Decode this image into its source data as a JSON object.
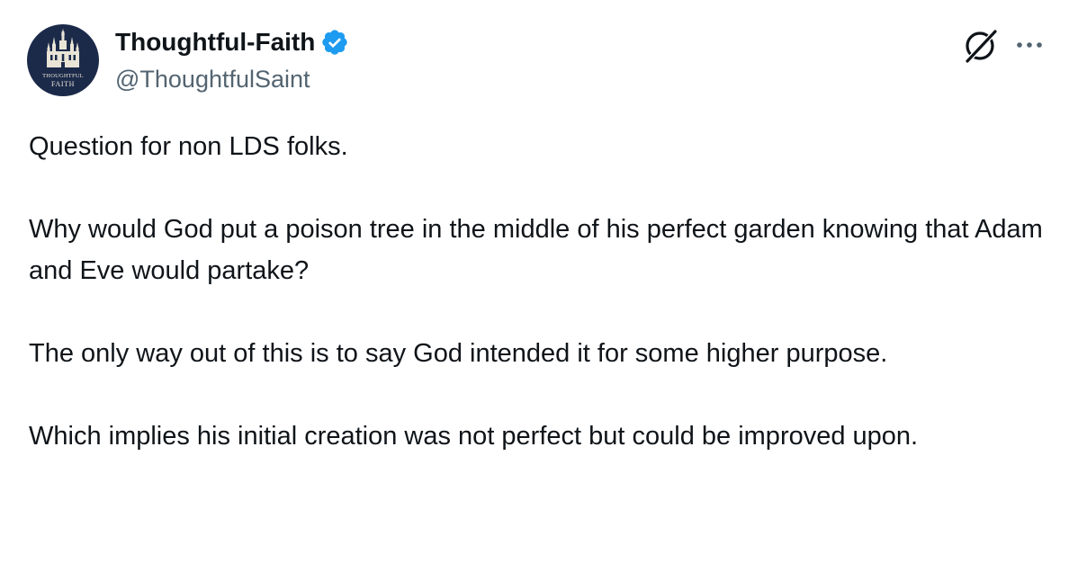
{
  "author": {
    "display_name": "Thoughtful-Faith",
    "handle": "@ThoughtfulSaint",
    "verified": true,
    "avatar_text_line1": "THOUGHTFUL",
    "avatar_text_line2": "FAITH",
    "avatar_icon": "temple-icon"
  },
  "actions": {
    "grok_icon": "grok-icon",
    "more_icon": "more-icon"
  },
  "tweet": {
    "paragraphs": [
      "Question for non LDS folks.",
      "Why would God put a poison tree in the middle of his perfect garden knowing that Adam and Eve would partake?",
      "The only way out of this is to say God intended it for some higher purpose.",
      "Which implies his initial creation was not perfect but could be improved upon."
    ]
  },
  "colors": {
    "text_primary": "#0f1419",
    "text_secondary": "#536471",
    "verified_blue": "#1d9bf0",
    "avatar_bg": "#1c2a4a"
  }
}
